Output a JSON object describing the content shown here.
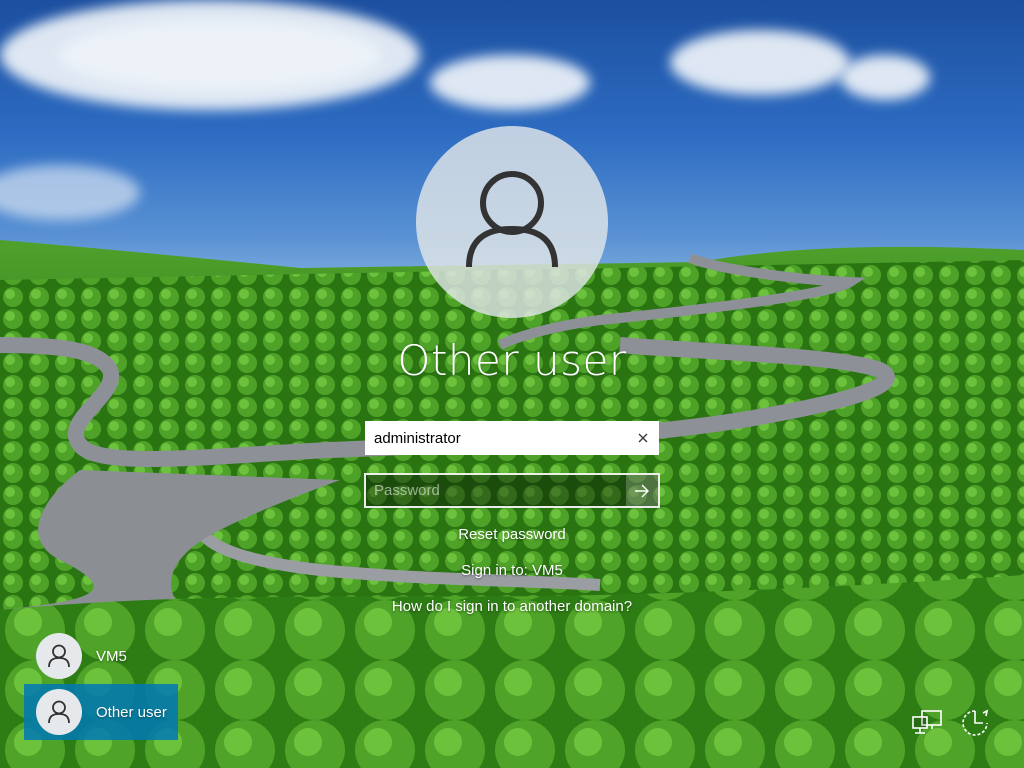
{
  "login": {
    "user_title": "Other user",
    "username_value": "administrator",
    "password_placeholder": "Password",
    "reset_password": "Reset password",
    "sign_in_to": "Sign in to: VM5",
    "other_domain": "How do I sign in to another domain?"
  },
  "users": [
    {
      "name": "VM5",
      "selected": false
    },
    {
      "name": "Other user",
      "selected": true
    }
  ],
  "icons": {
    "avatar": "user-silhouette-icon",
    "clear": "close-icon",
    "submit": "arrow-right-icon",
    "network": "network-icon",
    "ease_of_access": "ease-of-access-icon",
    "power": "power-icon"
  },
  "colors": {
    "selected_tile": "#0078b4",
    "avatar_bg": "#e1e5e8"
  }
}
